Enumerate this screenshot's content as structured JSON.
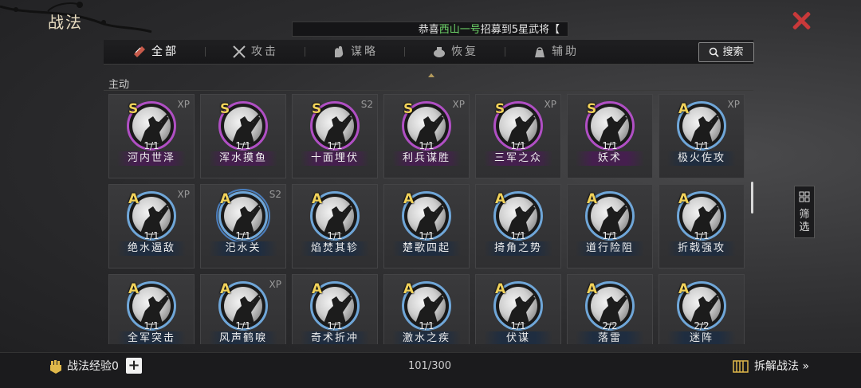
{
  "header": {
    "title": "战法"
  },
  "ticker": {
    "pre": "恭喜",
    "highlight": "西山一号",
    "post": "招募到5星武将【"
  },
  "tabs": [
    {
      "label": "全部",
      "icon": "scroll-icon",
      "active": true
    },
    {
      "label": "攻击",
      "icon": "crossed-swords-icon",
      "active": false
    },
    {
      "label": "谋略",
      "icon": "hand-icon",
      "active": false
    },
    {
      "label": "恢复",
      "icon": "pot-icon",
      "active": false
    },
    {
      "label": "辅助",
      "icon": "bag-icon",
      "active": false
    }
  ],
  "search": {
    "label": "搜索"
  },
  "section": {
    "label": "主动"
  },
  "cards": [
    {
      "grade": "S",
      "tag": "XP",
      "level": "1/1",
      "name": "河内世泽",
      "color": "purple"
    },
    {
      "grade": "S",
      "tag": "",
      "level": "1/1",
      "name": "浑水摸鱼",
      "color": "purple"
    },
    {
      "grade": "S",
      "tag": "S2",
      "level": "1/1",
      "name": "十面埋伏",
      "color": "purple"
    },
    {
      "grade": "S",
      "tag": "XP",
      "level": "1/1",
      "name": "利兵谋胜",
      "color": "purple"
    },
    {
      "grade": "S",
      "tag": "XP",
      "level": "1/1",
      "name": "三军之众",
      "color": "purple"
    },
    {
      "grade": "S",
      "tag": "",
      "level": "1/1",
      "name": "妖术",
      "color": "purple"
    },
    {
      "grade": "A",
      "tag": "XP",
      "level": "1/1",
      "name": "极火佐攻",
      "color": "blue"
    },
    {
      "grade": "A",
      "tag": "XP",
      "level": "1/1",
      "name": "绝水遏敌",
      "color": "blue"
    },
    {
      "grade": "A",
      "tag": "S2",
      "level": "1/1",
      "name": "汜水关",
      "color": "blue",
      "selected": true
    },
    {
      "grade": "A",
      "tag": "",
      "level": "1/1",
      "name": "焰焚其轸",
      "color": "blue"
    },
    {
      "grade": "A",
      "tag": "",
      "level": "1/1",
      "name": "楚歌四起",
      "color": "blue"
    },
    {
      "grade": "A",
      "tag": "",
      "level": "1/1",
      "name": "掎角之势",
      "color": "blue"
    },
    {
      "grade": "A",
      "tag": "",
      "level": "1/1",
      "name": "道行险阻",
      "color": "blue"
    },
    {
      "grade": "A",
      "tag": "",
      "level": "1/1",
      "name": "折戟强攻",
      "color": "blue"
    },
    {
      "grade": "A",
      "tag": "",
      "level": "1/1",
      "name": "全军突击",
      "color": "blue"
    },
    {
      "grade": "A",
      "tag": "XP",
      "level": "1/1",
      "name": "风声鹤唳",
      "color": "blue"
    },
    {
      "grade": "A",
      "tag": "",
      "level": "1/1",
      "name": "奇术折冲",
      "color": "blue"
    },
    {
      "grade": "A",
      "tag": "",
      "level": "1/1",
      "name": "激水之疾",
      "color": "blue"
    },
    {
      "grade": "A",
      "tag": "",
      "level": "1/1",
      "name": "伏谋",
      "color": "blue"
    },
    {
      "grade": "A",
      "tag": "",
      "level": "2/2",
      "name": "落雷",
      "color": "blue"
    },
    {
      "grade": "A",
      "tag": "",
      "level": "2/2",
      "name": "迷阵",
      "color": "blue"
    }
  ],
  "filter": {
    "label": "筛选"
  },
  "footer": {
    "xp_label": "战法经验0",
    "plus": "+",
    "count": "101/300",
    "decompose": "拆解战法 »"
  }
}
